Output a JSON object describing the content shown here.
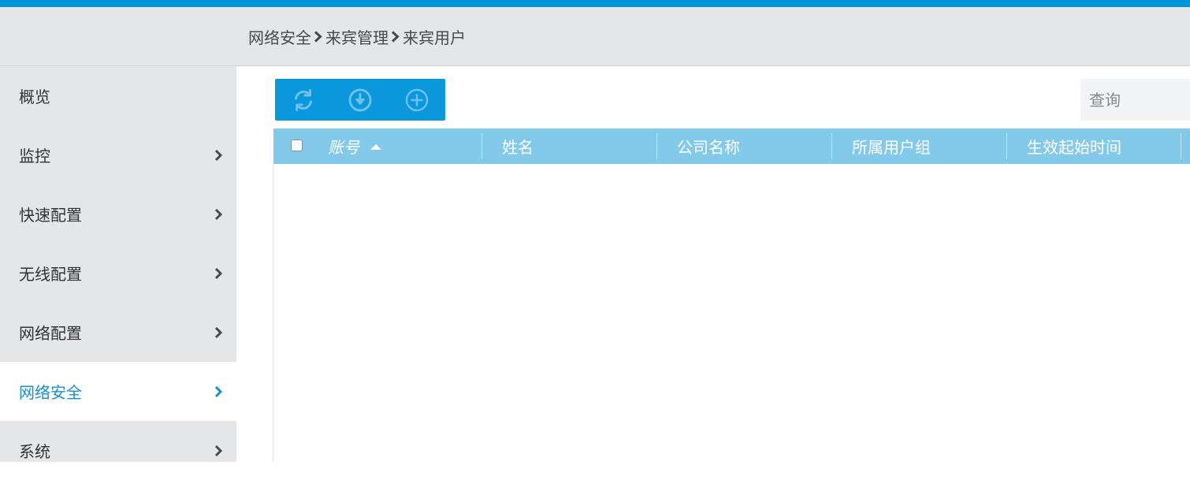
{
  "breadcrumb": {
    "items": [
      "网络安全",
      "来宾管理",
      "来宾用户"
    ]
  },
  "sidebar": {
    "items": [
      {
        "label": "概览",
        "has_chevron": false,
        "active": false
      },
      {
        "label": "监控",
        "has_chevron": true,
        "active": false
      },
      {
        "label": "快速配置",
        "has_chevron": true,
        "active": false
      },
      {
        "label": "无线配置",
        "has_chevron": true,
        "active": false
      },
      {
        "label": "网络配置",
        "has_chevron": true,
        "active": false
      },
      {
        "label": "网络安全",
        "has_chevron": true,
        "active": true
      },
      {
        "label": "系统",
        "has_chevron": true,
        "active": false
      }
    ]
  },
  "toolbar": {
    "buttons": [
      {
        "icon": "refresh-icon"
      },
      {
        "icon": "download-icon"
      },
      {
        "icon": "add-icon"
      }
    ]
  },
  "search": {
    "placeholder": "查询",
    "value": ""
  },
  "table": {
    "columns": [
      "账号",
      "姓名",
      "公司名称",
      "所属用户组",
      "生效起始时间"
    ],
    "sort_column": "账号",
    "sort_direction": "ascending",
    "rows": []
  },
  "colors": {
    "accent": "#0095d8",
    "active_text": "#1a8fd0",
    "header_bg": "#83c9ea",
    "sidebar_bg": "#e5e6e8"
  }
}
